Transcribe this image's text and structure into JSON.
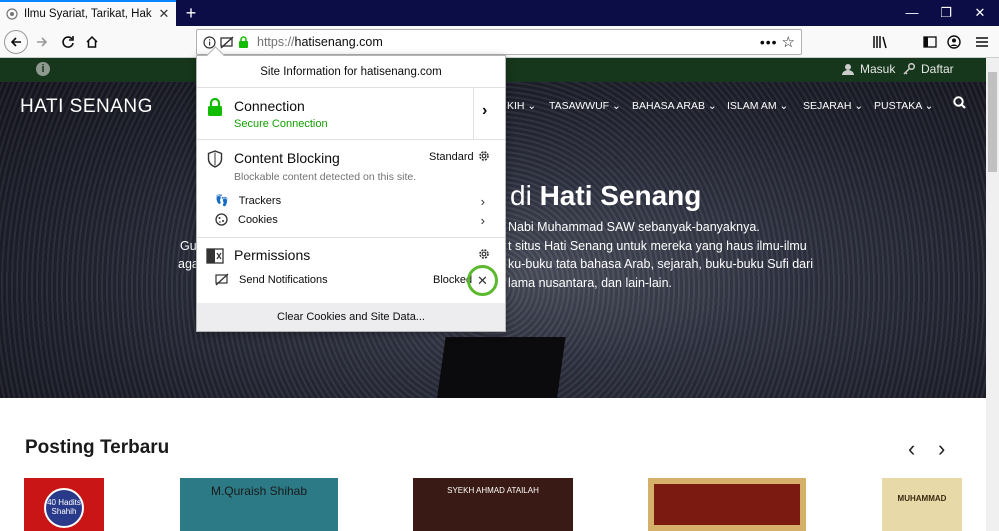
{
  "browser": {
    "tab_title": "Ilmu Syariat, Tarikat, Hakikat dan",
    "url_protocol": "https://",
    "url_host": "hatisenang.com"
  },
  "site": {
    "logo": "HATI SENANG",
    "login": "Masuk",
    "register": "Daftar",
    "menu": [
      "KIH",
      "TASAWWUF",
      "BAHASA ARAB",
      "ISLAM AM",
      "SEJARAH",
      "PUSTAKA"
    ],
    "hero_title_prefix": "di",
    "hero_title_bold": "Hati Senang",
    "hero_lines": [
      "Nabi Muhammad SAW sebanyak-banyaknya.",
      "t situs Hati Senang untuk mereka yang haus ilmu-ilmu",
      "ku-buku tata bahasa Arab, sejarah, buku-buku Sufi dari",
      "lama nusantara, dan lain-lain."
    ],
    "hero_left_fragments": [
      "Gu",
      "aga"
    ],
    "section_title": "Posting Terbaru",
    "books": [
      "40 Hadits Shahih",
      "M.Quraish Shihab",
      "SYEKH AHMAD ATAILAH",
      "",
      "MUHAMMAD"
    ]
  },
  "popup": {
    "header": "Site Information for hatisenang.com",
    "connection_title": "Connection",
    "connection_status": "Secure Connection",
    "blocking_title": "Content Blocking",
    "blocking_mode": "Standard",
    "blocking_desc": "Blockable content detected on this site.",
    "trackers": "Trackers",
    "cookies": "Cookies",
    "permissions_title": "Permissions",
    "permission_item": "Send Notifications",
    "permission_state": "Blocked",
    "footer": "Clear Cookies and Site Data..."
  },
  "colors": {
    "accent": "#0a84ff",
    "secure_green": "#12bc00",
    "highlight_ring": "#5cb82e",
    "site_topbar": "#16371b"
  }
}
